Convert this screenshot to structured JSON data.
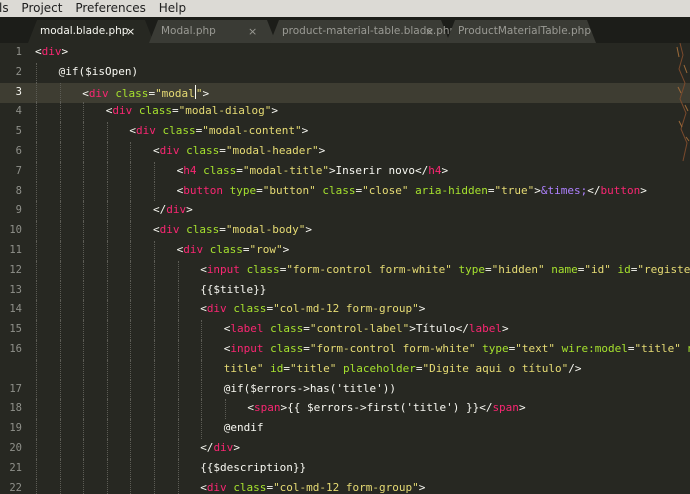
{
  "menu": [
    "ls",
    "Project",
    "Preferences",
    "Help"
  ],
  "tabs": [
    {
      "label": "modal.blade.php",
      "active": true
    },
    {
      "label": "Modal.php",
      "active": false
    },
    {
      "label": "product-material-table.blade.php",
      "active": false
    },
    {
      "label": "ProductMaterialTable.php",
      "active": false
    }
  ],
  "tab_close_glyph": "×",
  "current_line": 3,
  "colors": {
    "tag": "#f92672",
    "attr": "#a6e22e",
    "string": "#e6db74",
    "entity": "#ae81ff",
    "text": "#f8f8f2"
  },
  "code_lines": [
    {
      "n": 1,
      "indent": 0,
      "tokens": [
        [
          "p",
          "<"
        ],
        [
          "t",
          "div"
        ],
        [
          "p",
          ">"
        ]
      ]
    },
    {
      "n": 2,
      "indent": 1,
      "tokens": [
        [
          "p",
          "@if($isOpen)"
        ]
      ]
    },
    {
      "n": 3,
      "indent": 2,
      "tokens": [
        [
          "p",
          "<"
        ],
        [
          "t",
          "div"
        ],
        [
          "p",
          " "
        ],
        [
          "a",
          "class"
        ],
        [
          "p",
          "="
        ],
        [
          "s",
          "\"modal"
        ],
        [
          "caret",
          ""
        ],
        [
          "s",
          "\""
        ],
        [
          "p",
          ">"
        ]
      ]
    },
    {
      "n": 4,
      "indent": 3,
      "tokens": [
        [
          "p",
          "<"
        ],
        [
          "t",
          "div"
        ],
        [
          "p",
          " "
        ],
        [
          "a",
          "class"
        ],
        [
          "p",
          "="
        ],
        [
          "s",
          "\"modal-dialog\""
        ],
        [
          "p",
          ">"
        ]
      ]
    },
    {
      "n": 5,
      "indent": 4,
      "tokens": [
        [
          "p",
          "<"
        ],
        [
          "t",
          "div"
        ],
        [
          "p",
          " "
        ],
        [
          "a",
          "class"
        ],
        [
          "p",
          "="
        ],
        [
          "s",
          "\"modal-content\""
        ],
        [
          "p",
          ">"
        ]
      ]
    },
    {
      "n": 6,
      "indent": 5,
      "tokens": [
        [
          "p",
          "<"
        ],
        [
          "t",
          "div"
        ],
        [
          "p",
          " "
        ],
        [
          "a",
          "class"
        ],
        [
          "p",
          "="
        ],
        [
          "s",
          "\"modal-header\""
        ],
        [
          "p",
          ">"
        ]
      ]
    },
    {
      "n": 7,
      "indent": 6,
      "tokens": [
        [
          "p",
          "<"
        ],
        [
          "t",
          "h4"
        ],
        [
          "p",
          " "
        ],
        [
          "a",
          "class"
        ],
        [
          "p",
          "="
        ],
        [
          "s",
          "\"modal-title\""
        ],
        [
          "p",
          ">Inserir novo</"
        ],
        [
          "t",
          "h4"
        ],
        [
          "p",
          ">"
        ]
      ]
    },
    {
      "n": 8,
      "indent": 6,
      "tokens": [
        [
          "p",
          "<"
        ],
        [
          "t",
          "button"
        ],
        [
          "p",
          " "
        ],
        [
          "a",
          "type"
        ],
        [
          "p",
          "="
        ],
        [
          "s",
          "\"button\""
        ],
        [
          "p",
          " "
        ],
        [
          "a",
          "class"
        ],
        [
          "p",
          "="
        ],
        [
          "s",
          "\"close\""
        ],
        [
          "p",
          " "
        ],
        [
          "a",
          "aria-hidden"
        ],
        [
          "p",
          "="
        ],
        [
          "s",
          "\"true\""
        ],
        [
          "p",
          ">"
        ],
        [
          "e",
          "&times;"
        ],
        [
          "p",
          "</"
        ],
        [
          "t",
          "button"
        ],
        [
          "p",
          ">"
        ]
      ]
    },
    {
      "n": 9,
      "indent": 5,
      "tokens": [
        [
          "p",
          "</"
        ],
        [
          "t",
          "div"
        ],
        [
          "p",
          ">"
        ]
      ]
    },
    {
      "n": 10,
      "indent": 5,
      "tokens": [
        [
          "p",
          "<"
        ],
        [
          "t",
          "div"
        ],
        [
          "p",
          " "
        ],
        [
          "a",
          "class"
        ],
        [
          "p",
          "="
        ],
        [
          "s",
          "\"modal-body\""
        ],
        [
          "p",
          ">"
        ]
      ]
    },
    {
      "n": 11,
      "indent": 6,
      "tokens": [
        [
          "p",
          "<"
        ],
        [
          "t",
          "div"
        ],
        [
          "p",
          " "
        ],
        [
          "a",
          "class"
        ],
        [
          "p",
          "="
        ],
        [
          "s",
          "\"row\""
        ],
        [
          "p",
          ">"
        ]
      ]
    },
    {
      "n": 12,
      "indent": 7,
      "tokens": [
        [
          "p",
          "<"
        ],
        [
          "t",
          "input"
        ],
        [
          "p",
          " "
        ],
        [
          "a",
          "class"
        ],
        [
          "p",
          "="
        ],
        [
          "s",
          "\"form-control form-white\""
        ],
        [
          "p",
          " "
        ],
        [
          "a",
          "type"
        ],
        [
          "p",
          "="
        ],
        [
          "s",
          "\"hidden\""
        ],
        [
          "p",
          " "
        ],
        [
          "a",
          "name"
        ],
        [
          "p",
          "="
        ],
        [
          "s",
          "\"id\""
        ],
        [
          "p",
          " "
        ],
        [
          "a",
          "id"
        ],
        [
          "p",
          "="
        ],
        [
          "s",
          "\"registerId\""
        ],
        [
          "p",
          "/>"
        ]
      ]
    },
    {
      "n": 13,
      "indent": 7,
      "tokens": [
        [
          "p",
          "{{$title}}"
        ]
      ]
    },
    {
      "n": 14,
      "indent": 7,
      "tokens": [
        [
          "p",
          "<"
        ],
        [
          "t",
          "div"
        ],
        [
          "p",
          " "
        ],
        [
          "a",
          "class"
        ],
        [
          "p",
          "="
        ],
        [
          "s",
          "\"col-md-12 form-group\""
        ],
        [
          "p",
          ">"
        ]
      ]
    },
    {
      "n": 15,
      "indent": 8,
      "tokens": [
        [
          "p",
          "<"
        ],
        [
          "t",
          "label"
        ],
        [
          "p",
          " "
        ],
        [
          "a",
          "class"
        ],
        [
          "p",
          "="
        ],
        [
          "s",
          "\"control-label\""
        ],
        [
          "p",
          ">Título</"
        ],
        [
          "t",
          "label"
        ],
        [
          "p",
          ">"
        ]
      ]
    },
    {
      "n": 16,
      "indent": 8,
      "tokens": [
        [
          "p",
          "<"
        ],
        [
          "t",
          "input"
        ],
        [
          "p",
          " "
        ],
        [
          "a",
          "class"
        ],
        [
          "p",
          "="
        ],
        [
          "s",
          "\"form-control form-white\""
        ],
        [
          "p",
          " "
        ],
        [
          "a",
          "type"
        ],
        [
          "p",
          "="
        ],
        [
          "s",
          "\"text\""
        ],
        [
          "p",
          " "
        ],
        [
          "a",
          "wire:model"
        ],
        [
          "p",
          "="
        ],
        [
          "s",
          "\"title\""
        ],
        [
          "p",
          " "
        ],
        [
          "a",
          "name"
        ],
        [
          "p",
          "="
        ],
        [
          "s",
          "\""
        ]
      ]
    },
    {
      "n": null,
      "indent": 8,
      "tokens": [
        [
          "s",
          "title\""
        ],
        [
          "p",
          " "
        ],
        [
          "a",
          "id"
        ],
        [
          "p",
          "="
        ],
        [
          "s",
          "\"title\""
        ],
        [
          "p",
          " "
        ],
        [
          "a",
          "placeholder"
        ],
        [
          "p",
          "="
        ],
        [
          "s",
          "\"Digite aqui o título\""
        ],
        [
          "p",
          "/>"
        ]
      ]
    },
    {
      "n": 17,
      "indent": 8,
      "tokens": [
        [
          "p",
          "@if($errors->has('title'))"
        ]
      ]
    },
    {
      "n": 18,
      "indent": 9,
      "tokens": [
        [
          "p",
          "<"
        ],
        [
          "t",
          "span"
        ],
        [
          "p",
          ">{{ $errors->first('title') }}</"
        ],
        [
          "t",
          "span"
        ],
        [
          "p",
          ">"
        ]
      ]
    },
    {
      "n": 19,
      "indent": 8,
      "tokens": [
        [
          "p",
          "@endif"
        ]
      ]
    },
    {
      "n": 20,
      "indent": 7,
      "tokens": [
        [
          "p",
          "</"
        ],
        [
          "t",
          "div"
        ],
        [
          "p",
          ">"
        ]
      ]
    },
    {
      "n": 21,
      "indent": 7,
      "tokens": [
        [
          "p",
          "{{$description}}"
        ]
      ]
    },
    {
      "n": 22,
      "indent": 7,
      "tokens": [
        [
          "p",
          "<"
        ],
        [
          "t",
          "div"
        ],
        [
          "p",
          " "
        ],
        [
          "a",
          "class"
        ],
        [
          "p",
          "="
        ],
        [
          "s",
          "\"col-md-12 form-group\""
        ],
        [
          "p",
          ">"
        ]
      ]
    }
  ]
}
